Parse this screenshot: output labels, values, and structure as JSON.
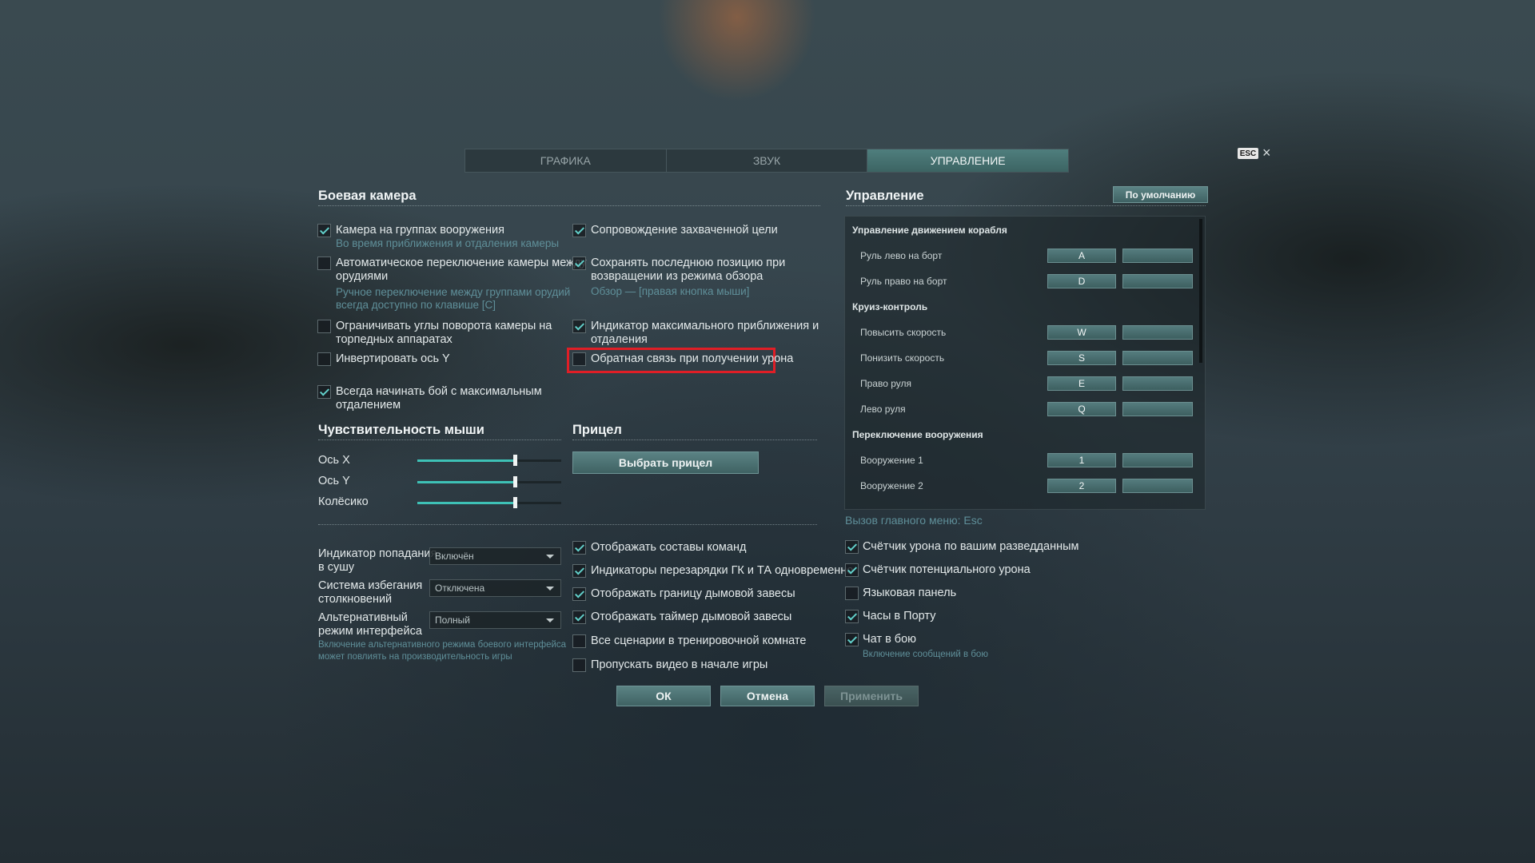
{
  "tabs": [
    {
      "label": "ГРАФИКА",
      "active": false
    },
    {
      "label": "ЗВУК",
      "active": false
    },
    {
      "label": "УПРАВЛЕНИЕ",
      "active": true
    }
  ],
  "esc_key": "ESC",
  "close_icon": "×",
  "combat_camera": {
    "title": "Боевая камера",
    "left": [
      {
        "checked": true,
        "lines": [
          "Камера на группах вооружения"
        ],
        "hint": [
          "Во время приближения и отдаления камеры"
        ]
      },
      {
        "checked": false,
        "lines": [
          "Автоматическое переключение камеры между",
          "орудиями"
        ],
        "hint": [
          "Ручное переключение между группами орудий",
          "всегда доступно по клавише [C]"
        ]
      },
      {
        "checked": false,
        "lines": [
          "Ограничивать углы поворота камеры на",
          "торпедных аппаратах"
        ],
        "hint": []
      },
      {
        "checked": false,
        "lines": [
          "Инвертировать ось Y"
        ],
        "hint": []
      },
      {
        "checked": true,
        "lines": [
          "Всегда начинать бой с максимальным",
          "отдалением"
        ],
        "hint": []
      }
    ],
    "right": [
      {
        "checked": true,
        "lines": [
          "Сопровождение захваченной цели"
        ],
        "hint": []
      },
      {
        "checked": true,
        "lines": [
          "Сохранять последнюю позицию при",
          "возвращении из режима обзора"
        ],
        "hint": [
          "Обзор — [правая кнопка мыши]"
        ]
      },
      {
        "checked": true,
        "lines": [
          "Индикатор максимального приближения и",
          "отдаления"
        ],
        "hint": []
      },
      {
        "checked": false,
        "lines": [
          "Обратная связь при получении урона"
        ],
        "hint": []
      }
    ]
  },
  "mouse": {
    "title": "Чувствительность мыши",
    "sliders": [
      {
        "label": "Ось X",
        "value": 0.68
      },
      {
        "label": "Ось Y",
        "value": 0.68
      },
      {
        "label": "Колёсико",
        "value": 0.68
      }
    ]
  },
  "sight": {
    "title": "Прицел",
    "button": "Выбрать прицел"
  },
  "dropdowns": [
    {
      "lines": [
        "Индикатор попадания",
        "в сушу"
      ],
      "value": "Включён"
    },
    {
      "lines": [
        "Система избегания",
        "столкновений"
      ],
      "value": "Отключена"
    },
    {
      "lines": [
        "Альтернативный",
        "режим интерфейса"
      ],
      "value": "Полный"
    }
  ],
  "interface_hint": [
    "Включение альтернативного режима боевого интерфейса",
    "может повлиять на производительность игры"
  ],
  "middle_checks": [
    {
      "checked": true,
      "label": "Отображать составы команд"
    },
    {
      "checked": true,
      "label": "Индикаторы перезарядки ГК и ТА одновременно"
    },
    {
      "checked": true,
      "label": "Отображать границу дымовой завесы"
    },
    {
      "checked": true,
      "label": "Отображать таймер дымовой завесы"
    },
    {
      "checked": false,
      "label": "Все сценарии в тренировочной комнате"
    },
    {
      "checked": false,
      "label": "Пропускать видео в начале игры"
    }
  ],
  "controls": {
    "title": "Управление",
    "default_button": "По умолчанию",
    "rows": [
      {
        "type": "group",
        "label": "Управление движением корабля"
      },
      {
        "type": "bind",
        "label": "Руль лево на борт",
        "key": "A"
      },
      {
        "type": "bind",
        "label": "Руль право на борт",
        "key": "D"
      },
      {
        "type": "group",
        "label": "Круиз-контроль"
      },
      {
        "type": "bind",
        "label": "Повысить скорость",
        "key": "W"
      },
      {
        "type": "bind",
        "label": "Понизить скорость",
        "key": "S"
      },
      {
        "type": "bind",
        "label": "Право руля",
        "key": "E"
      },
      {
        "type": "bind",
        "label": "Лево руля",
        "key": "Q"
      },
      {
        "type": "group",
        "label": "Переключение вооружения"
      },
      {
        "type": "bind",
        "label": "Вооружение 1",
        "key": "1"
      },
      {
        "type": "bind",
        "label": "Вооружение 2",
        "key": "2"
      }
    ],
    "menu_hint": "Вызов главного меню: Esc"
  },
  "right_checks": [
    {
      "checked": true,
      "label": "Счётчик урона по вашим разведданным"
    },
    {
      "checked": true,
      "label": "Счётчик потенциального урона"
    },
    {
      "checked": false,
      "label": "Языковая панель"
    },
    {
      "checked": true,
      "label": "Часы в Порту"
    },
    {
      "checked": true,
      "label": "Чат в бою"
    }
  ],
  "chat_hint": "Включение сообщений в бою",
  "footer": {
    "ok": "ОК",
    "cancel": "Отмена",
    "apply": "Применить"
  },
  "colors": {
    "accent": "#3ec1b6",
    "highlight": "#e01e26",
    "hint": "#5f8f99"
  }
}
